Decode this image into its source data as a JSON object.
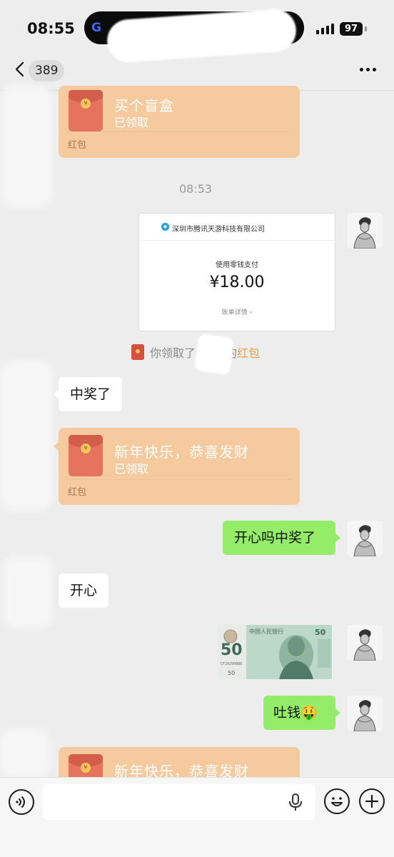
{
  "status_bar": {
    "time": "08:55",
    "island_text": "G",
    "battery": "97"
  },
  "nav": {
    "unread_count": "389"
  },
  "messages": {
    "packet1": {
      "title": "买个盲盒",
      "status": "已领取",
      "label": "红包"
    },
    "timestamp": "08:53",
    "receipt": {
      "company": "深圳市腾讯天游科技有限公司",
      "method": "使用零钱支付",
      "amount": "¥18.00",
      "details": "账单详情 ›"
    },
    "system_notice": {
      "prefix": "你领取了",
      "suffix": "的",
      "link": "红包"
    },
    "bubble1": "中奖了",
    "packet2": {
      "title": "新年快乐，恭喜发财",
      "status": "已领取",
      "label": "红包"
    },
    "bubble2": "开心吗中奖了",
    "bubble3": "开心",
    "banknote": {
      "denomination": "50",
      "bank": "中国人民银行",
      "serial": "CF29290888"
    },
    "bubble4": "吐钱",
    "bubble4_emoji": "🤑",
    "packet3": {
      "title": "新年快乐，恭喜发财"
    }
  },
  "colors": {
    "packet_bg": "#f4ca9e",
    "self_bubble": "#95ec69",
    "other_bubble": "#ffffff",
    "chat_bg": "#ededed"
  },
  "icons": {
    "back": "chevron-left-icon",
    "more": "more-dots-icon",
    "voice": "voice-icon",
    "mic": "microphone-icon",
    "emoji": "emoji-icon",
    "plus": "plus-icon"
  }
}
